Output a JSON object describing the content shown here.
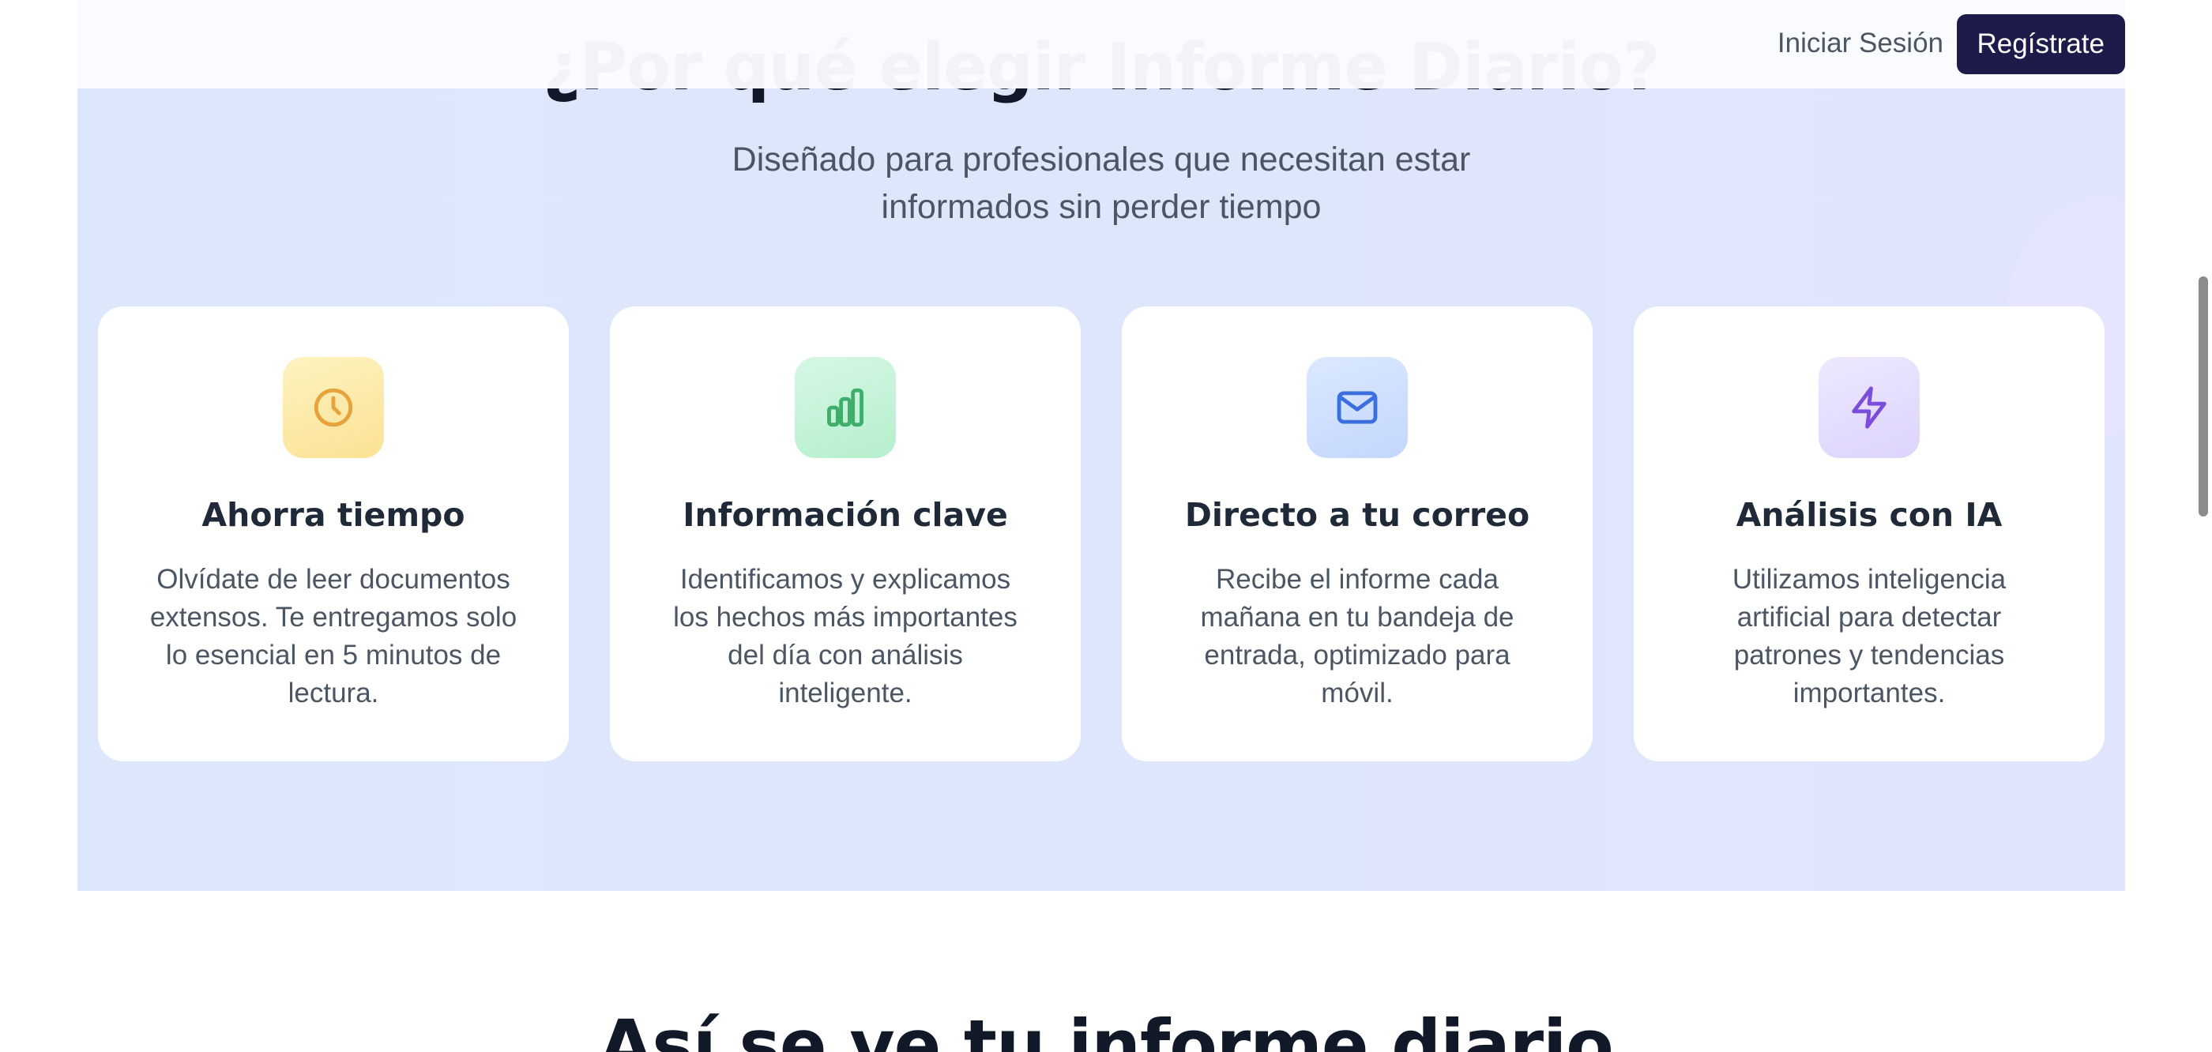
{
  "header": {
    "login_label": "Iniciar Sesión",
    "signup_label": "Regístrate"
  },
  "features": {
    "title": "¿Por qué elegir Informe Diario?",
    "subtitle_line1": "Diseñado para profesionales que necesitan estar",
    "subtitle_line2": "informados sin perder tiempo",
    "cards": [
      {
        "icon": "clock-icon",
        "icon_color": "#e8a23b",
        "title": "Ahorra tiempo",
        "description": "Olvídate de leer documentos extensos. Te entregamos solo lo esencial en 5 minutos de lectura."
      },
      {
        "icon": "bar-chart-icon",
        "icon_color": "#3fae6b",
        "title": "Información clave",
        "description": "Identificamos y explicamos los hechos más importantes del día con análisis inteligente."
      },
      {
        "icon": "mail-icon",
        "icon_color": "#3b6fe0",
        "title": "Directo a tu correo",
        "description": "Recibe el informe cada mañana en tu bandeja de entrada, optimizado para móvil."
      },
      {
        "icon": "lightning-icon",
        "icon_color": "#7c4ddb",
        "title": "Análisis con IA",
        "description": "Utilizamos inteligencia artificial para detectar patrones y tendencias importantes."
      }
    ]
  },
  "next_section": {
    "title": "Así se ve tu informe diario"
  },
  "colors": {
    "primary_button": "#1e1b4b",
    "section_background": "#dee6fc"
  }
}
